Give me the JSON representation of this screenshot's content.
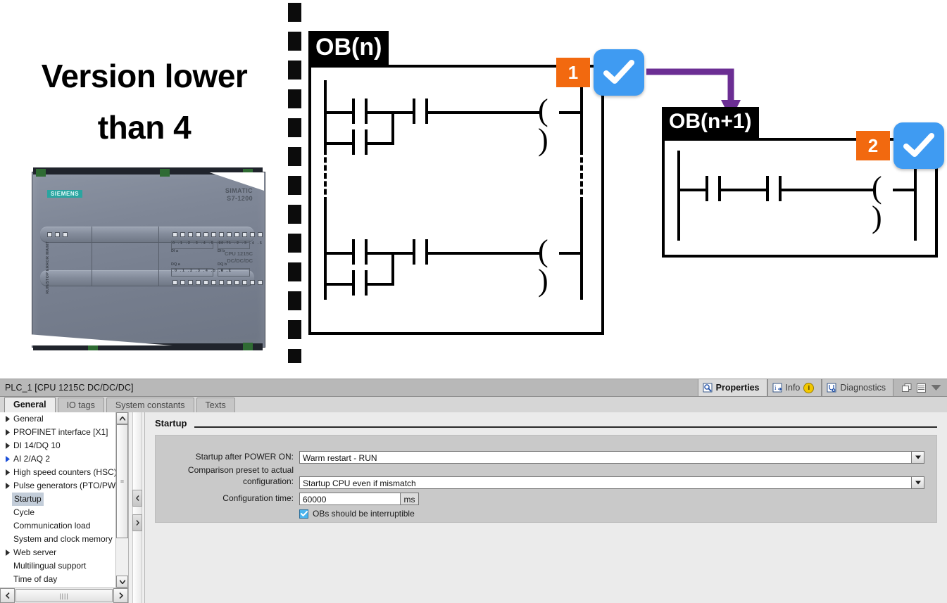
{
  "diagram": {
    "headline": "Version lower than 4",
    "headline_line1": "Version lower",
    "headline_line2": "than 4",
    "device": {
      "brand": "SIEMENS",
      "family_line1": "SIMATIC",
      "family_line2": "S7-1200",
      "cpu_line1": "CPU 1215C",
      "cpu_line2": "DC/DC/DC",
      "led_labels": "RUN/STOP  ERROR  MAINT",
      "input_group_a": "DI a",
      "input_group_b": "DI b",
      "input_a_bits": "0 .1 .2 .3 .4 .5 .6 .7",
      "input_b_bits": ".0 .1 .2 .3 .4 .5",
      "output_group_a": "DQ a",
      "output_group_b": "DQ b",
      "output_a_bits": ".0 .1 .2 .3 .4 .5 .6 .7",
      "output_b_bits": ".0 .1"
    },
    "blocks": [
      {
        "id": "ob-n",
        "title": "OB(n)",
        "badge": "1"
      },
      {
        "id": "ob-n1",
        "title": "OB(n+1)",
        "badge": "2"
      }
    ],
    "colors": {
      "badge_orange": "#f2690f",
      "check_blue": "#3f9bf2",
      "arrow_purple": "#6b2e93",
      "block_black": "#000000"
    }
  },
  "inspector": {
    "title": "PLC_1 [CPU 1215C DC/DC/DC]",
    "toolbuttons": [
      {
        "label": "Properties",
        "icon": "properties-icon",
        "active": true
      },
      {
        "label": "Info",
        "icon": "info-icon",
        "badge": "i",
        "active": false
      },
      {
        "label": "Diagnostics",
        "icon": "diagnostics-icon",
        "active": false
      }
    ],
    "window_icons": [
      "restore-icon",
      "maximize-icon",
      "collapse-icon"
    ],
    "tabs": [
      {
        "label": "General",
        "active": true
      },
      {
        "label": "IO tags",
        "active": false
      },
      {
        "label": "System constants",
        "active": false
      },
      {
        "label": "Texts",
        "active": false
      }
    ],
    "nav": {
      "items": [
        {
          "label": "General",
          "expandable": true,
          "selected": false
        },
        {
          "label": "PROFINET interface [X1]",
          "expandable": true,
          "selected": false
        },
        {
          "label": "DI 14/DQ 10",
          "expandable": true,
          "selected": false
        },
        {
          "label": "AI 2/AQ 2",
          "expandable": true,
          "selected": false
        },
        {
          "label": "High speed counters (HSC)",
          "expandable": true,
          "selected": false
        },
        {
          "label": "Pulse generators (PTO/PWM)",
          "expandable": true,
          "selected": false
        },
        {
          "label": "Startup",
          "expandable": false,
          "selected": true
        },
        {
          "label": "Cycle",
          "expandable": false,
          "selected": false
        },
        {
          "label": "Communication load",
          "expandable": false,
          "selected": false
        },
        {
          "label": "System and clock memory",
          "expandable": false,
          "selected": false
        },
        {
          "label": "Web server",
          "expandable": true,
          "selected": false
        },
        {
          "label": "Multilingual support",
          "expandable": false,
          "selected": false
        },
        {
          "label": "Time of day",
          "expandable": false,
          "selected": false
        }
      ]
    },
    "form": {
      "section_title": "Startup",
      "fields": [
        {
          "label": "Startup after POWER ON:",
          "value": "Warm restart - RUN",
          "type": "dropdown"
        },
        {
          "label_line1": "Comparison preset to actual",
          "label_line2": "configuration:",
          "value": "Startup CPU even if mismatch",
          "type": "dropdown"
        },
        {
          "label": "Configuration time:",
          "value": "60000",
          "unit": "ms",
          "type": "text"
        }
      ],
      "checkbox": {
        "label": "OBs should be interruptible",
        "checked": true
      }
    }
  }
}
